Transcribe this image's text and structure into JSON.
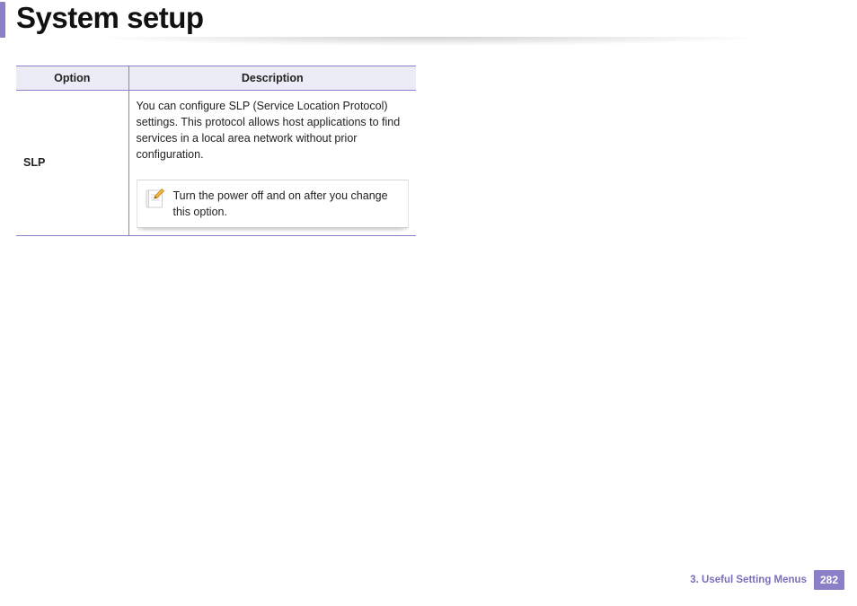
{
  "page": {
    "title": "System setup"
  },
  "table": {
    "headers": {
      "option": "Option",
      "description": "Description"
    },
    "rows": [
      {
        "option": "SLP",
        "description": "You can configure SLP (Service Location Protocol) settings. This protocol allows host applications to find services in a local area network without prior configuration.",
        "note": "Turn the power off and on after you change this option."
      }
    ]
  },
  "footer": {
    "section": "3.  Useful Setting Menus",
    "page_number": "282"
  }
}
